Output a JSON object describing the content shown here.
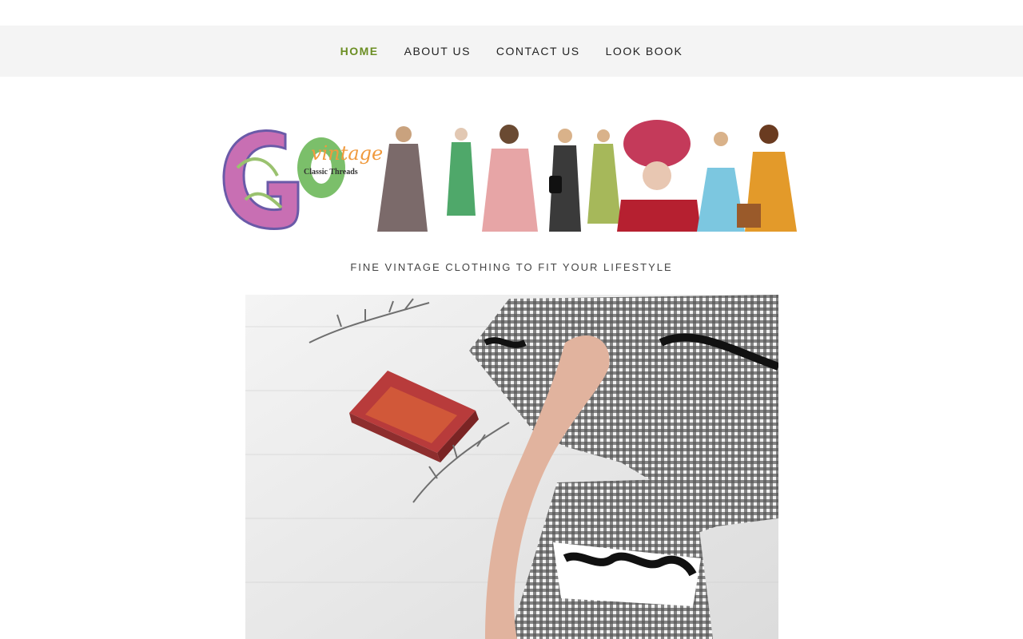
{
  "nav": {
    "items": [
      {
        "label": "HOME",
        "active": true
      },
      {
        "label": "ABOUT US",
        "active": false
      },
      {
        "label": "CONTACT US",
        "active": false
      },
      {
        "label": "LOOK BOOK",
        "active": false
      }
    ]
  },
  "banner": {
    "logo_big": "GO",
    "logo_script": "vintage",
    "logo_sub": "Classic Threads"
  },
  "tagline": "FINE VINTAGE CLOTHING TO FIT YOUR LIFESTYLE",
  "colors": {
    "accent": "#6b8e23",
    "nav_bg": "#f4f4f4"
  }
}
